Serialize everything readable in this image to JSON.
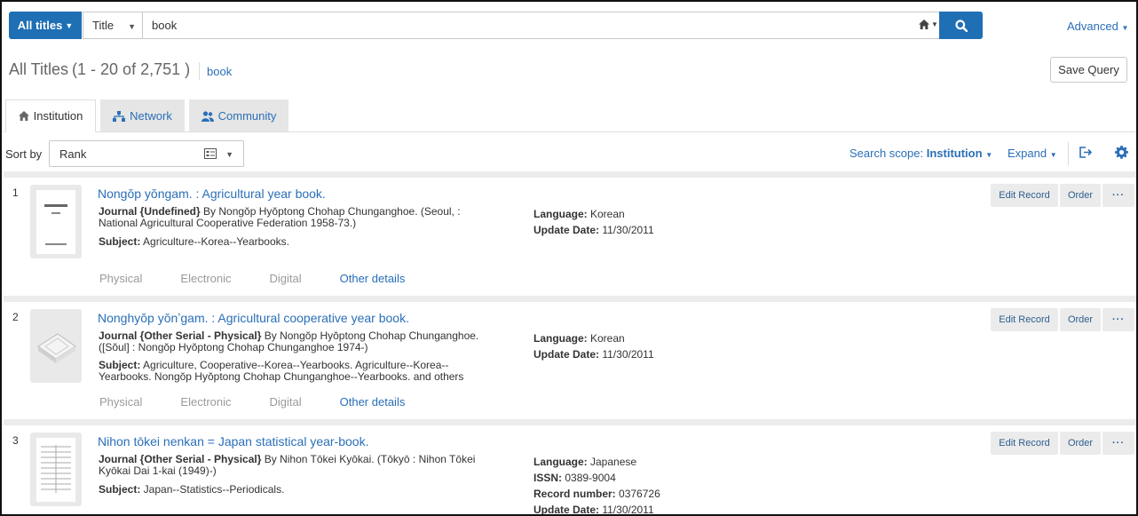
{
  "search": {
    "scope_label": "All titles",
    "field_label": "Title",
    "query": "book",
    "search_icon": "magnifier-icon",
    "home_icon": "home-icon",
    "advanced_label": "Advanced"
  },
  "results_header": {
    "title": "All Titles",
    "range": "(1 - 20 of 2,751 )",
    "query_chip": "book",
    "save_query_label": "Save Query"
  },
  "tabs": [
    {
      "label": "Institution",
      "icon": "home-icon",
      "active": true
    },
    {
      "label": "Network",
      "icon": "network-icon",
      "active": false
    },
    {
      "label": "Community",
      "icon": "users-icon",
      "active": false
    }
  ],
  "toolbar": {
    "sort_label": "Sort by",
    "sort_value": "Rank",
    "scope_prefix": "Search scope:",
    "scope_value": "Institution",
    "expand_label": "Expand"
  },
  "actions": {
    "edit": "Edit Record",
    "order": "Order",
    "more": "···"
  },
  "result_links": [
    "Physical",
    "Electronic",
    "Digital",
    "Other details"
  ],
  "results": [
    {
      "num": "1",
      "title": "Nongŏp yŏngam. : Agricultural year book.",
      "type": "Journal {Undefined}",
      "by": " By Nongŏp Hyŏptong Chohap Chunganghoe. (Seoul, : National Agricultural Cooperative Federation 1958-73.)",
      "subject_label": "Subject:",
      "subject": " Agriculture--Korea--Yearbooks.",
      "meta": [
        {
          "k": "Language:",
          "v": " Korean"
        },
        {
          "k": "Update Date:",
          "v": " 11/30/2011"
        }
      ]
    },
    {
      "num": "2",
      "title": "Nonghyŏp yŏnʼgam. : Agricultural cooperative year book.",
      "type": "Journal {Other Serial - Physical}",
      "by": " By Nongŏp Hyŏptong Chohap Chunganghoe. ([Sŏul] : Nongŏp Hyŏptong Chohap Chunganghoe 1974-)",
      "subject_label": "Subject:",
      "subject": " Agriculture, Cooperative--Korea--Yearbooks. Agriculture--Korea--Yearbooks. Nongŏp Hyŏptong Chohap Chunganghoe--Yearbooks. and others",
      "meta": [
        {
          "k": "Language:",
          "v": " Korean"
        },
        {
          "k": "Update Date:",
          "v": " 11/30/2011"
        }
      ]
    },
    {
      "num": "3",
      "title": "Nihon tōkei nenkan = Japan statistical year-book.",
      "type": "Journal {Other Serial - Physical}",
      "by": " By Nihon Tōkei Kyōkai. (Tōkyō : Nihon Tōkei Kyōkai Dai 1-kai (1949)-)",
      "subject_label": "Subject:",
      "subject": " Japan--Statistics--Periodicals.",
      "meta": [
        {
          "k": "Language:",
          "v": " Japanese"
        },
        {
          "k": "ISSN:",
          "v": " 0389-9004"
        },
        {
          "k": "Record number:",
          "v": " 0376726"
        },
        {
          "k": "Update Date:",
          "v": " 11/30/2011"
        }
      ]
    }
  ]
}
